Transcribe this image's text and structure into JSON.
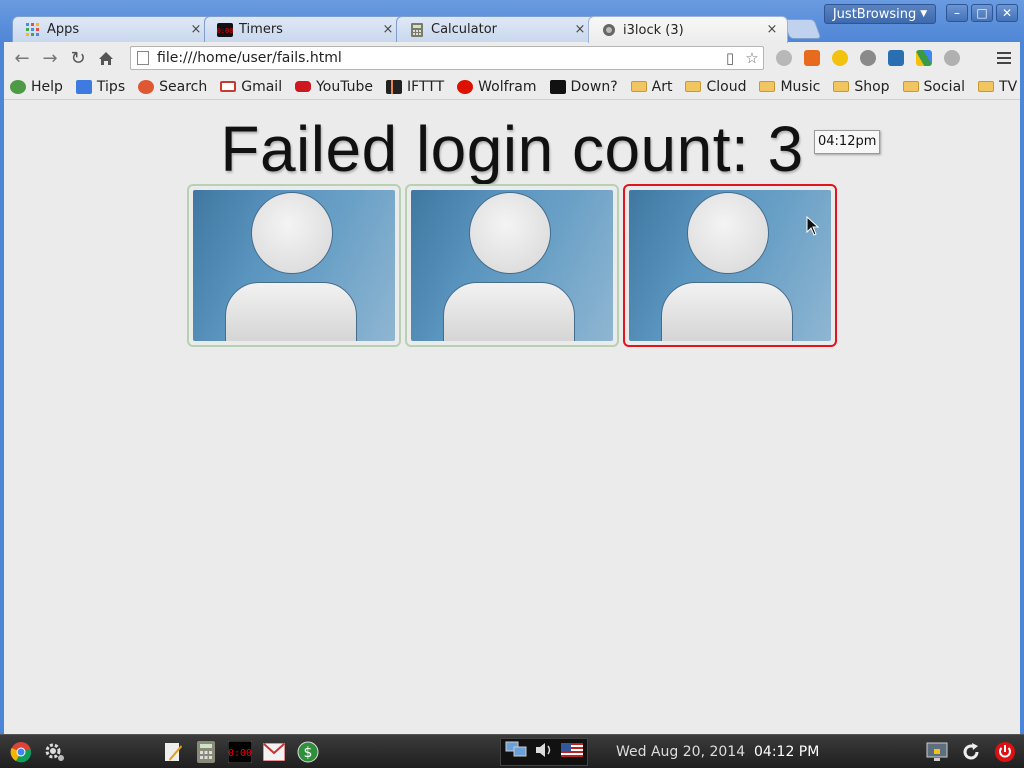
{
  "window": {
    "profile_name": "JustBrowsing",
    "tabs": [
      {
        "title": "Apps",
        "icon": "apps-grid-icon",
        "active": false
      },
      {
        "title": "Timers",
        "icon": "timer-icon",
        "active": false
      },
      {
        "title": "Calculator",
        "icon": "calculator-icon",
        "active": false
      },
      {
        "title": "i3lock (3)",
        "icon": "lock-globe-icon",
        "active": true
      }
    ],
    "close_symbol": "×",
    "buttons": {
      "minimize": "–",
      "maximize": "□",
      "close": "✕"
    }
  },
  "toolbar": {
    "url": "file:///home/user/fails.html",
    "back_icon": "back-arrow-icon",
    "forward_icon": "forward-arrow-icon",
    "reload_icon": "reload-icon",
    "home_icon": "home-icon",
    "extensions": [
      {
        "name": "search-extension-icon",
        "color": "#9a9a9a"
      },
      {
        "name": "fox-extension-icon",
        "color": "#e86a1c"
      },
      {
        "name": "honey-extension-icon",
        "color": "#f2c20e"
      },
      {
        "name": "privacy-extension-icon",
        "color": "#8a8a8a"
      },
      {
        "name": "screenshot-extension-icon",
        "color": "#2b6fb3"
      },
      {
        "name": "drive-extension-icon",
        "color": "#3b9b45"
      },
      {
        "name": "hangouts-extension-icon",
        "color": "#b0b0b0"
      }
    ]
  },
  "bookmarks": [
    {
      "label": "Help",
      "icon": "help-icon",
      "color": "#4f9a47",
      "folder": false
    },
    {
      "label": "Tips",
      "icon": "google-plus-icon",
      "color": "#3f7ae0",
      "folder": false
    },
    {
      "label": "Search",
      "icon": "duckduckgo-icon",
      "color": "#de5833",
      "folder": false
    },
    {
      "label": "Gmail",
      "icon": "gmail-icon",
      "color": "#c9392f",
      "folder": false
    },
    {
      "label": "YouTube",
      "icon": "youtube-icon",
      "color": "#cc181e",
      "folder": false
    },
    {
      "label": "IFTTT",
      "icon": "ifttt-icon",
      "color": "#222222",
      "folder": false
    },
    {
      "label": "Wolfram",
      "icon": "wolfram-icon",
      "color": "#dd1100",
      "folder": false
    },
    {
      "label": "Down?",
      "icon": "down-checker-icon",
      "color": "#111111",
      "folder": false
    },
    {
      "label": "Art",
      "icon": "folder-icon",
      "color": "#f1c660",
      "folder": true
    },
    {
      "label": "Cloud",
      "icon": "folder-icon",
      "color": "#f1c660",
      "folder": true
    },
    {
      "label": "Music",
      "icon": "folder-icon",
      "color": "#f1c660",
      "folder": true
    },
    {
      "label": "Shop",
      "icon": "folder-icon",
      "color": "#f1c660",
      "folder": true
    },
    {
      "label": "Social",
      "icon": "folder-icon",
      "color": "#f1c660",
      "folder": true
    },
    {
      "label": "TV",
      "icon": "folder-icon",
      "color": "#f1c660",
      "folder": true
    }
  ],
  "page": {
    "title": "Failed login count: 3",
    "attempts": [
      {
        "name": "login-attempt-1",
        "status": "ok",
        "border_color": "#b7d1b3"
      },
      {
        "name": "login-attempt-2",
        "status": "ok",
        "border_color": "#b7d1b3"
      },
      {
        "name": "login-attempt-3",
        "status": "failed",
        "border_color": "#e1151b"
      }
    ],
    "tooltip": "04:12pm"
  },
  "taskbar": {
    "launchers": [
      "chrome-icon",
      "settings-gear-icon",
      "text-editor-icon",
      "calculator-icon",
      "timer-icon",
      "mail-icon",
      "money-icon"
    ],
    "tray": [
      "network-icon",
      "volume-icon",
      "us-flag-icon"
    ],
    "clock_date": "Wed Aug 20, 2014",
    "clock_time": "04:12 PM",
    "right_icons": [
      "display-lock-icon",
      "refresh-icon",
      "power-icon"
    ]
  }
}
